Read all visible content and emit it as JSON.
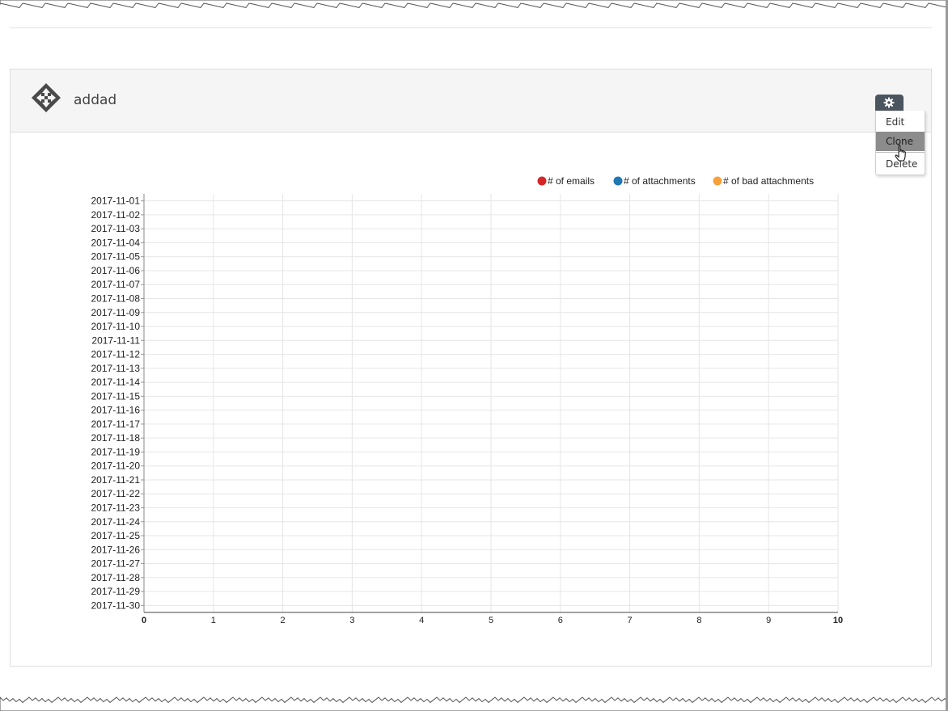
{
  "widget": {
    "title": "addad",
    "menu": {
      "items": [
        {
          "label": "Edit"
        },
        {
          "label": "Clone"
        },
        {
          "label": "Delete"
        }
      ],
      "active_index": 1
    }
  },
  "icons": {
    "drag": "move-arrows-icon",
    "settings": "gear-icon",
    "pointer": "hand-pointer-icon"
  },
  "colors": {
    "emails": "#d62728",
    "attachments": "#1f77b4",
    "bad_attachments": "#f7a13c",
    "header_bg": "#f5f5f5",
    "gear_bg": "#4b5560"
  },
  "chart_data": {
    "type": "bar",
    "orientation": "horizontal",
    "categories": [
      "2017-11-01",
      "2017-11-02",
      "2017-11-03",
      "2017-11-04",
      "2017-11-05",
      "2017-11-06",
      "2017-11-07",
      "2017-11-08",
      "2017-11-09",
      "2017-11-10",
      "2017-11-11",
      "2017-11-12",
      "2017-11-13",
      "2017-11-14",
      "2017-11-15",
      "2017-11-16",
      "2017-11-17",
      "2017-11-18",
      "2017-11-19",
      "2017-11-20",
      "2017-11-21",
      "2017-11-22",
      "2017-11-23",
      "2017-11-24",
      "2017-11-25",
      "2017-11-26",
      "2017-11-27",
      "2017-11-28",
      "2017-11-29",
      "2017-11-30"
    ],
    "series": [
      {
        "name": "# of emails",
        "color": "#d62728",
        "values": [
          0,
          0,
          0,
          0,
          0,
          0,
          0,
          0,
          0,
          0,
          0,
          0,
          0,
          0,
          0,
          0,
          0,
          0,
          0,
          0,
          0,
          0,
          0,
          0,
          0,
          0,
          0,
          0,
          0,
          0
        ]
      },
      {
        "name": "# of attachments",
        "color": "#1f77b4",
        "values": [
          0,
          0,
          0,
          0,
          0,
          0,
          0,
          0,
          0,
          0,
          0,
          0,
          0,
          0,
          0,
          0,
          0,
          0,
          0,
          0,
          0,
          0,
          0,
          0,
          0,
          0,
          0,
          0,
          0,
          0
        ]
      },
      {
        "name": "# of bad attachments",
        "color": "#f7a13c",
        "values": [
          0,
          0,
          0,
          0,
          0,
          0,
          0,
          0,
          0,
          0,
          0,
          0,
          0,
          0,
          0,
          0,
          0,
          0,
          0,
          0,
          0,
          0,
          0,
          0,
          0,
          0,
          0,
          0,
          0,
          0
        ]
      }
    ],
    "xlim": [
      0,
      10
    ],
    "xticks": [
      0,
      1,
      2,
      3,
      4,
      5,
      6,
      7,
      8,
      9,
      10
    ],
    "grid": true,
    "legend": "top-right",
    "title": "",
    "xlabel": "",
    "ylabel": ""
  }
}
